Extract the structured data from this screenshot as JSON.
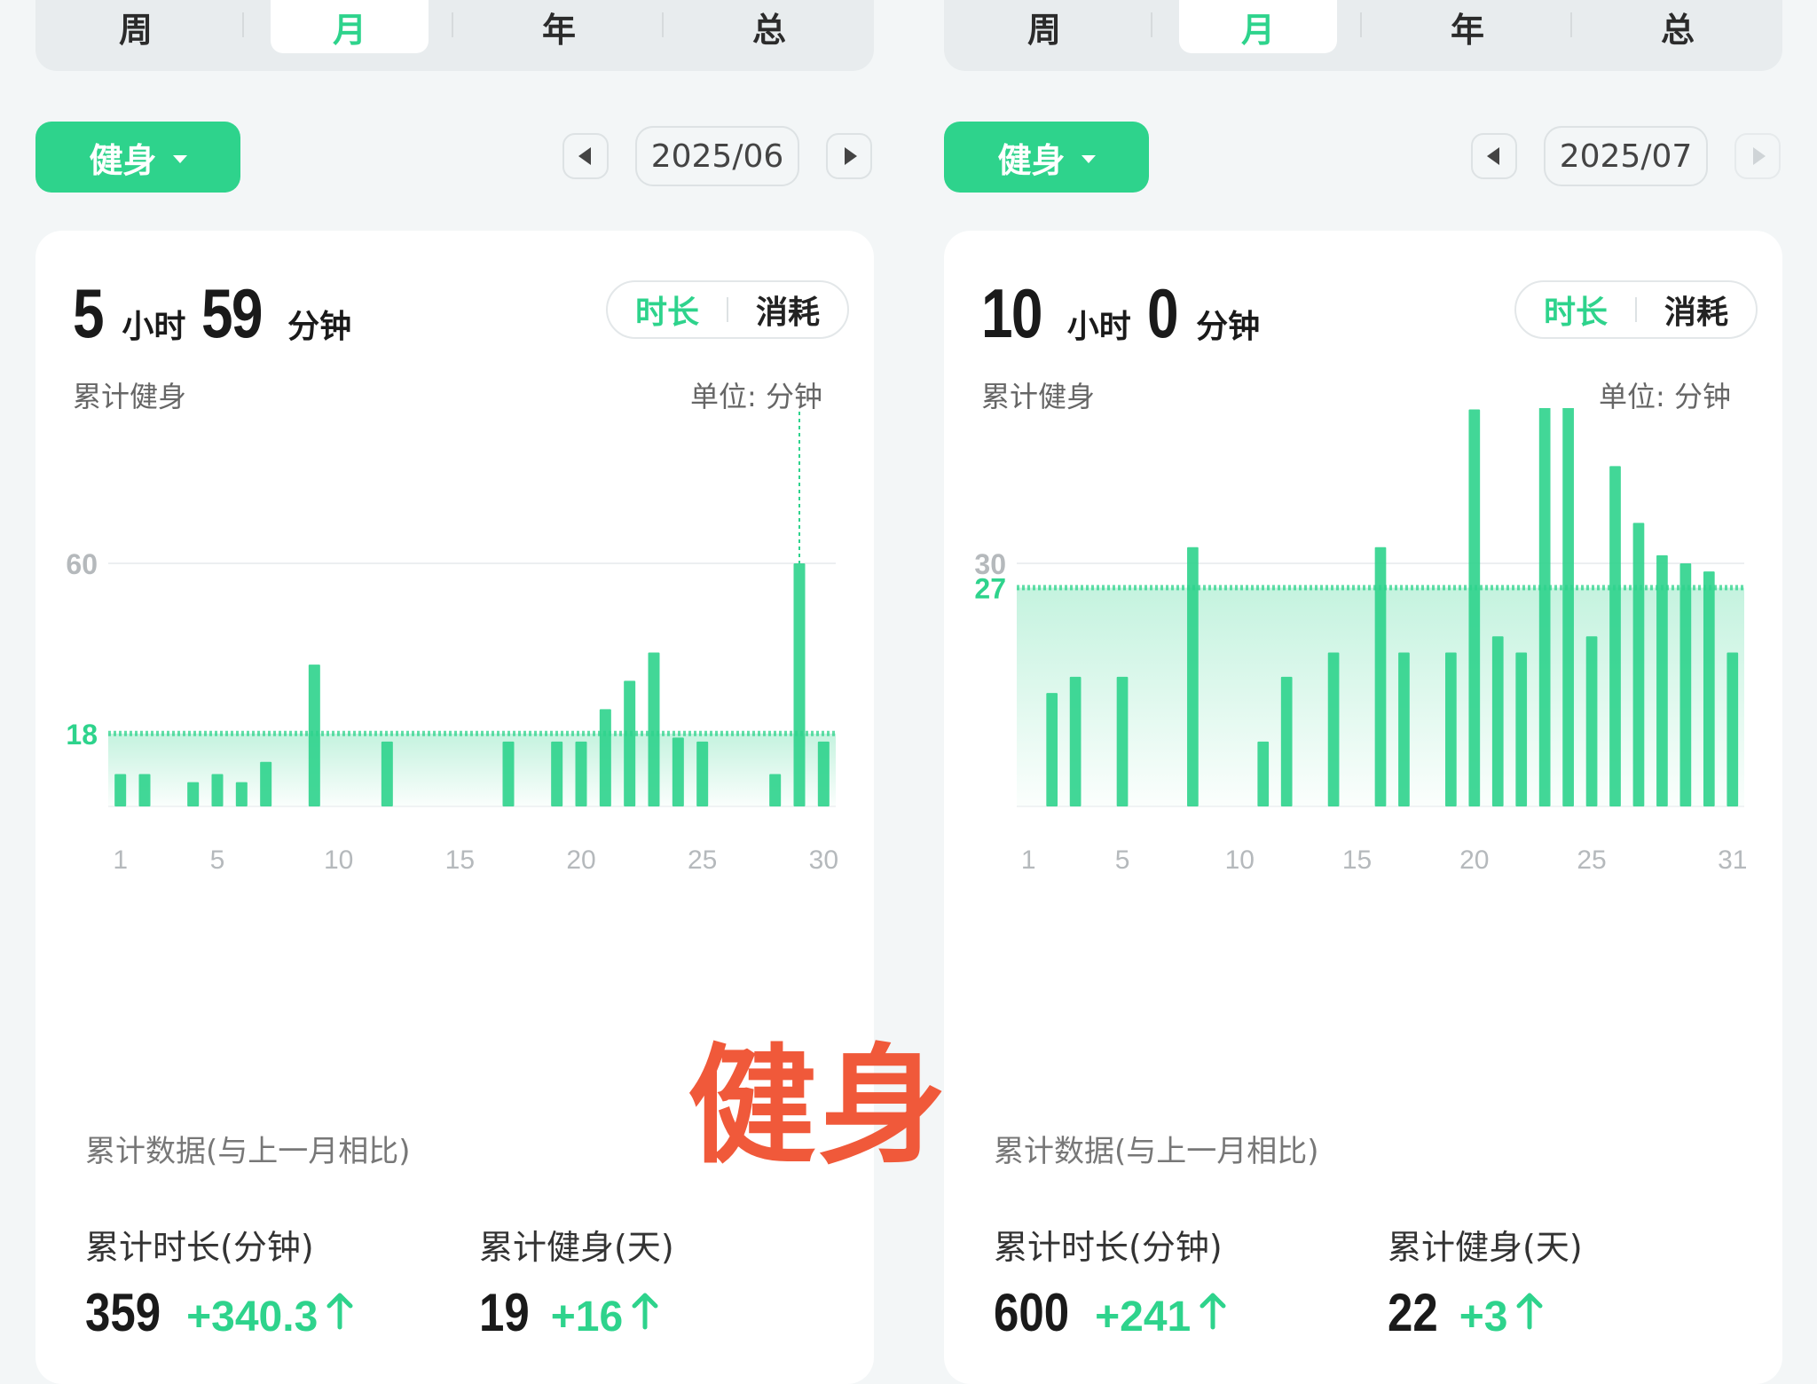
{
  "watermark": "健身",
  "colors": {
    "accent": "#2ed38c",
    "background": "#f3f6f7",
    "card": "#ffffff",
    "watermark": "#f0593a"
  },
  "panels": [
    {
      "tabs": [
        "周",
        "月",
        "年",
        "总"
      ],
      "active_tab": "月",
      "category": "健身",
      "period": "2025/06",
      "total": {
        "hours": "5",
        "hours_unit": "小时",
        "minutes": "59",
        "minutes_unit": "分钟"
      },
      "toggle": {
        "on": "时长",
        "off": "消耗"
      },
      "subtitle": "累计健身",
      "unit_label": "单位: 分钟",
      "cumulative_title": "累计数据(与上一月相比)",
      "stats": [
        {
          "label": "累计时长(分钟)",
          "value": "359",
          "delta": "+340.3",
          "trend": "up-arrow-icon"
        },
        {
          "label": "累计健身(天)",
          "value": "19",
          "delta": "+16",
          "trend": "up-arrow-icon"
        }
      ],
      "next_enabled": true
    },
    {
      "tabs": [
        "周",
        "月",
        "年",
        "总"
      ],
      "active_tab": "月",
      "category": "健身",
      "period": "2025/07",
      "total": {
        "hours": "10",
        "hours_unit": "小时",
        "minutes": "0",
        "minutes_unit": "分钟"
      },
      "toggle": {
        "on": "时长",
        "off": "消耗"
      },
      "subtitle": "累计健身",
      "unit_label": "单位: 分钟",
      "cumulative_title": "累计数据(与上一月相比)",
      "stats": [
        {
          "label": "累计时长(分钟)",
          "value": "600",
          "delta": "+241",
          "trend": "up-arrow-icon"
        },
        {
          "label": "累计健身(天)",
          "value": "22",
          "delta": "+3",
          "trend": "up-arrow-icon"
        }
      ],
      "next_enabled": false
    }
  ],
  "chart_data": [
    {
      "type": "bar",
      "ylabel": "单位: 分钟",
      "ylim": [
        0,
        120
      ],
      "yticks": [
        120,
        60
      ],
      "xticks": [
        1,
        5,
        10,
        15,
        20,
        25,
        30
      ],
      "average": 18,
      "highlight": {
        "day": 29,
        "value": 60
      },
      "grid": true,
      "x": [
        1,
        2,
        3,
        4,
        5,
        6,
        7,
        8,
        9,
        10,
        11,
        12,
        13,
        14,
        15,
        16,
        17,
        18,
        19,
        20,
        21,
        22,
        23,
        24,
        25,
        26,
        27,
        28,
        29,
        30
      ],
      "values": [
        8,
        8,
        0,
        6,
        8,
        6,
        11,
        0,
        35,
        0,
        0,
        16,
        0,
        0,
        0,
        0,
        16,
        0,
        16,
        16,
        24,
        31,
        38,
        17,
        16,
        0,
        0,
        8,
        60,
        16
      ]
    },
    {
      "type": "bar",
      "ylabel": "单位: 分钟",
      "ylim": [
        0,
        60
      ],
      "yticks": [
        60,
        30
      ],
      "xticks": [
        1,
        5,
        10,
        15,
        20,
        25,
        31
      ],
      "average": 27,
      "highlight": {
        "day": 23,
        "value": 59
      },
      "grid": true,
      "x": [
        1,
        2,
        3,
        4,
        5,
        6,
        7,
        8,
        9,
        10,
        11,
        12,
        13,
        14,
        15,
        16,
        17,
        18,
        19,
        20,
        21,
        22,
        23,
        24,
        25,
        26,
        27,
        28,
        29,
        30,
        31
      ],
      "values": [
        0,
        14,
        16,
        0,
        16,
        0,
        0,
        32,
        0,
        0,
        8,
        16,
        0,
        19,
        0,
        32,
        19,
        0,
        19,
        49,
        21,
        19,
        59,
        50,
        21,
        42,
        35,
        31,
        30,
        29,
        19
      ]
    }
  ]
}
